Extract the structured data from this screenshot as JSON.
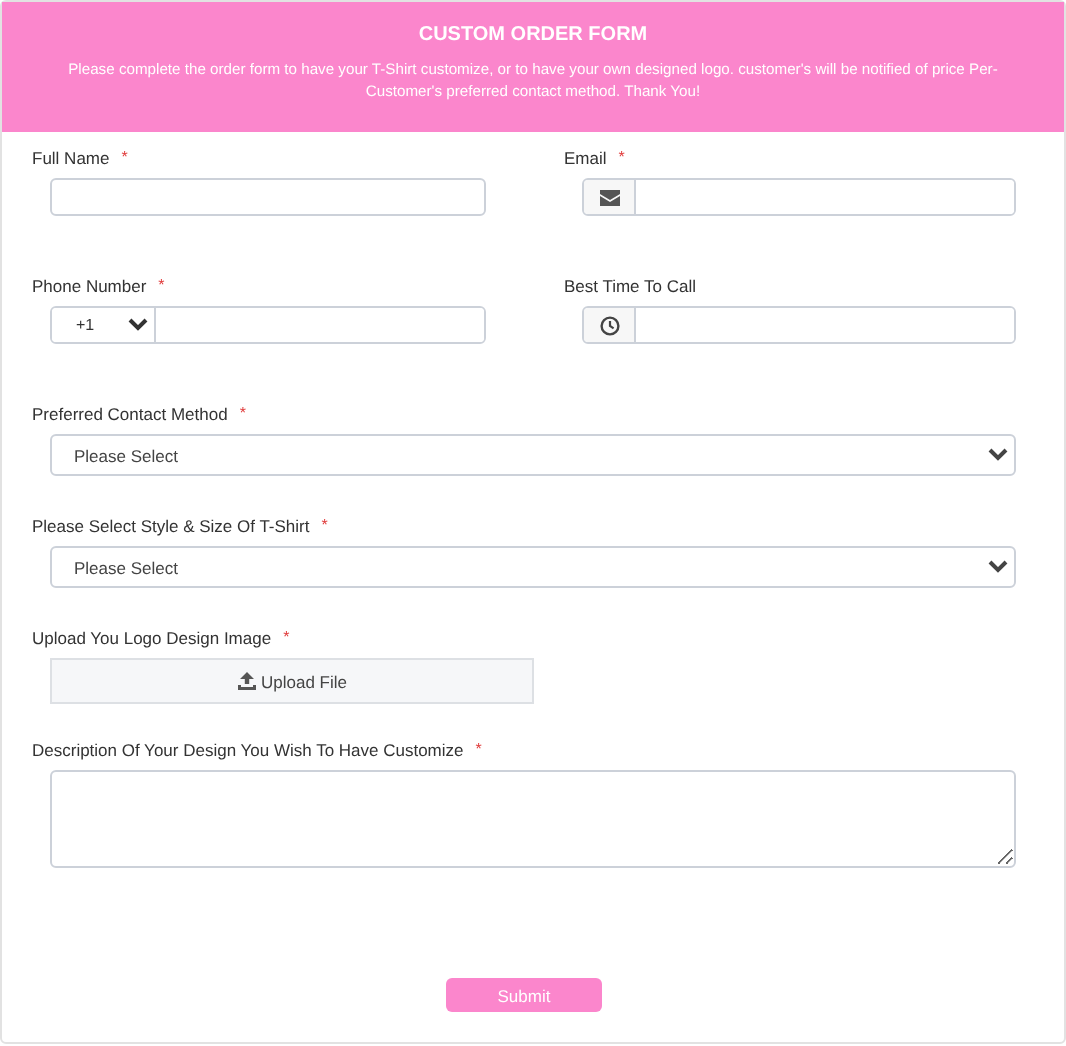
{
  "header": {
    "title": "CUSTOM ORDER FORM",
    "subtitle": "Please complete the order form to have your T-Shirt customize, or to have your own designed logo. customer's will be notified of price Per-Customer's preferred contact method. Thank You!"
  },
  "rows": [
    [
      {
        "kind": "text",
        "label": "Full Name",
        "marker": "*"
      },
      {
        "kind": "email",
        "label": "Email",
        "marker": "*"
      }
    ],
    [
      {
        "kind": "phone",
        "label": "Phone Number",
        "marker": "*",
        "country": "+1"
      },
      {
        "kind": "time",
        "label": "Best Time To Call"
      }
    ],
    [
      {
        "kind": "select",
        "label": "Preferred Contact Method",
        "marker": "*",
        "value": "Please Select"
      }
    ],
    [
      {
        "kind": "select",
        "label": "Please Select Style & Size Of T-Shirt",
        "marker": "*",
        "value": "Please Select"
      }
    ],
    [
      {
        "kind": "upload",
        "label": "Upload You Logo Design Image",
        "marker": "*",
        "button": "Upload File"
      }
    ],
    [
      {
        "kind": "textarea",
        "label": "Description Of Your Design You Wish To Have Customize",
        "marker": "*"
      }
    ]
  ],
  "submit": "Submit"
}
